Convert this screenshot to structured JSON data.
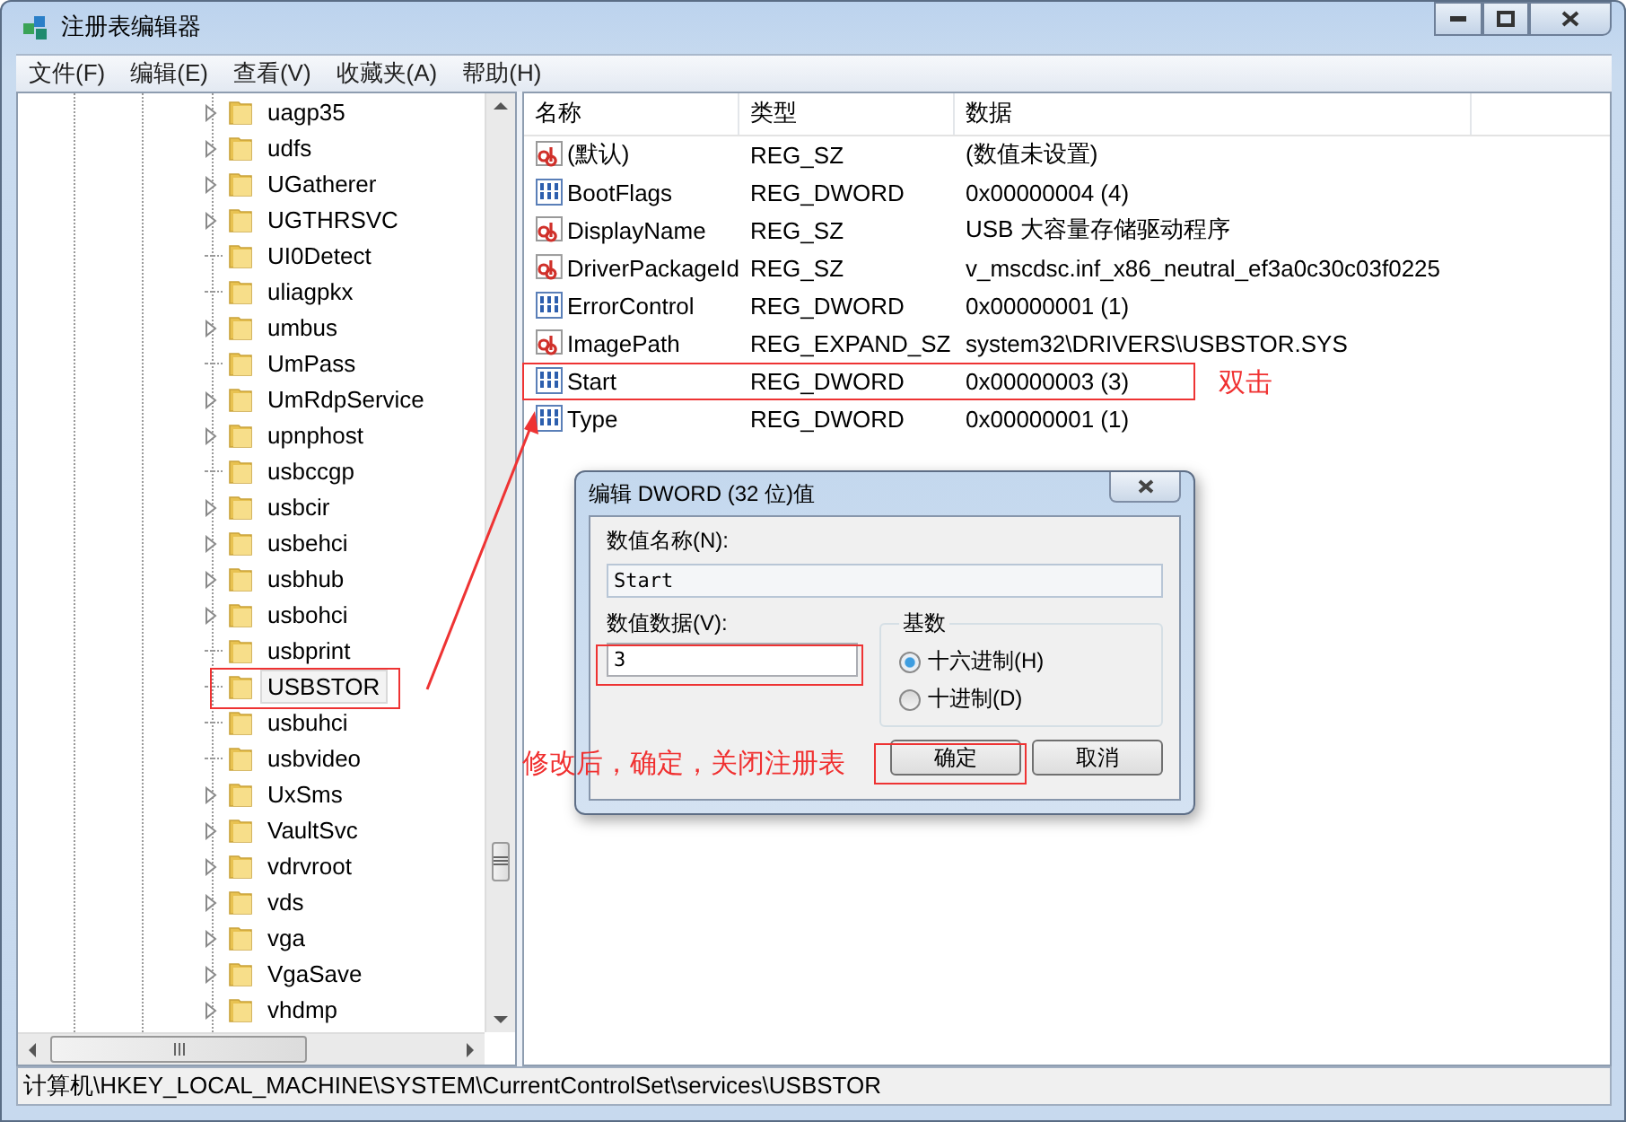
{
  "window": {
    "title": "注册表编辑器"
  },
  "menu": [
    "文件(F)",
    "编辑(E)",
    "查看(V)",
    "收藏夹(A)",
    "帮助(H)"
  ],
  "tree": {
    "items": [
      {
        "label": "uagp35",
        "expandable": true,
        "selected": false
      },
      {
        "label": "udfs",
        "expandable": true,
        "selected": false
      },
      {
        "label": "UGatherer",
        "expandable": true,
        "selected": false
      },
      {
        "label": "UGTHRSVC",
        "expandable": true,
        "selected": false
      },
      {
        "label": "UI0Detect",
        "expandable": false,
        "selected": false
      },
      {
        "label": "uliagpkx",
        "expandable": false,
        "selected": false
      },
      {
        "label": "umbus",
        "expandable": true,
        "selected": false
      },
      {
        "label": "UmPass",
        "expandable": false,
        "selected": false
      },
      {
        "label": "UmRdpService",
        "expandable": true,
        "selected": false
      },
      {
        "label": "upnphost",
        "expandable": true,
        "selected": false
      },
      {
        "label": "usbccgp",
        "expandable": false,
        "selected": false
      },
      {
        "label": "usbcir",
        "expandable": true,
        "selected": false
      },
      {
        "label": "usbehci",
        "expandable": true,
        "selected": false
      },
      {
        "label": "usbhub",
        "expandable": true,
        "selected": false
      },
      {
        "label": "usbohci",
        "expandable": true,
        "selected": false
      },
      {
        "label": "usbprint",
        "expandable": false,
        "selected": false
      },
      {
        "label": "USBSTOR",
        "expandable": false,
        "selected": true
      },
      {
        "label": "usbuhci",
        "expandable": false,
        "selected": false
      },
      {
        "label": "usbvideo",
        "expandable": false,
        "selected": false
      },
      {
        "label": "UxSms",
        "expandable": true,
        "selected": false
      },
      {
        "label": "VaultSvc",
        "expandable": true,
        "selected": false
      },
      {
        "label": "vdrvroot",
        "expandable": true,
        "selected": false
      },
      {
        "label": "vds",
        "expandable": true,
        "selected": false
      },
      {
        "label": "vga",
        "expandable": true,
        "selected": false
      },
      {
        "label": "VgaSave",
        "expandable": true,
        "selected": false
      },
      {
        "label": "vhdmp",
        "expandable": true,
        "selected": false
      }
    ]
  },
  "values": {
    "columns": [
      "名称",
      "类型",
      "数据"
    ],
    "rows": [
      {
        "kind": "string",
        "name": "(默认)",
        "type": "REG_SZ",
        "data": "(数值未设置)"
      },
      {
        "kind": "binary",
        "name": "BootFlags",
        "type": "REG_DWORD",
        "data": "0x00000004 (4)"
      },
      {
        "kind": "string",
        "name": "DisplayName",
        "type": "REG_SZ",
        "data": "USB 大容量存储驱动程序"
      },
      {
        "kind": "string",
        "name": "DriverPackageId",
        "type": "REG_SZ",
        "data": "v_mscdsc.inf_x86_neutral_ef3a0c30c03f0225"
      },
      {
        "kind": "binary",
        "name": "ErrorControl",
        "type": "REG_DWORD",
        "data": "0x00000001 (1)"
      },
      {
        "kind": "string",
        "name": "ImagePath",
        "type": "REG_EXPAND_SZ",
        "data": "system32\\DRIVERS\\USBSTOR.SYS"
      },
      {
        "kind": "binary",
        "name": "Start",
        "type": "REG_DWORD",
        "data": "0x00000003 (3)"
      },
      {
        "kind": "binary",
        "name": "Type",
        "type": "REG_DWORD",
        "data": "0x00000001 (1)"
      }
    ]
  },
  "dialog": {
    "title": "编辑 DWORD (32 位)值",
    "name_label": "数值名称(N):",
    "name_value": "Start",
    "data_label": "数值数据(V):",
    "data_value": "3",
    "base_label": "基数",
    "bases": [
      {
        "label": "十六进制(H)",
        "selected": true
      },
      {
        "label": "十进制(D)",
        "selected": false
      }
    ],
    "buttons": [
      "确定",
      "取消"
    ]
  },
  "status_bar": "计算机\\HKEY_LOCAL_MACHINE\\SYSTEM\\CurrentControlSet\\services\\USBSTOR",
  "annotations": [
    "双击",
    "修改后，确定，关闭注册表"
  ]
}
